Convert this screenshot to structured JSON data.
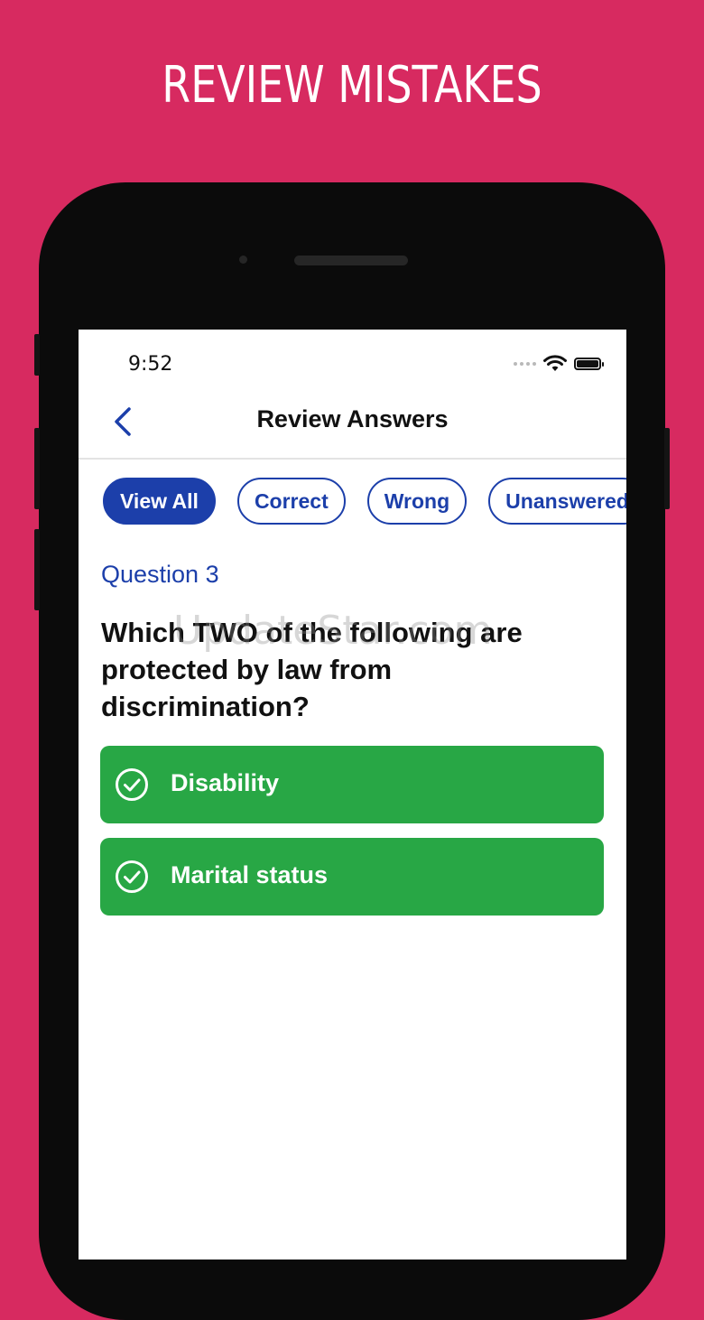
{
  "banner": {
    "headline": "REVIEW MISTAKES"
  },
  "status_bar": {
    "time": "9:52"
  },
  "nav": {
    "title": "Review Answers"
  },
  "filters": [
    {
      "label": "View All",
      "active": true
    },
    {
      "label": "Correct",
      "active": false
    },
    {
      "label": "Wrong",
      "active": false
    },
    {
      "label": "Unanswered",
      "active": false
    }
  ],
  "question": {
    "number_label": "Question 3",
    "text": "Which TWO of the following are protected by law from discrimination?"
  },
  "answers": [
    {
      "label": "Disability",
      "state": "correct"
    },
    {
      "label": "Marital status",
      "state": "correct"
    }
  ],
  "watermark": "UpdateStar.com",
  "colors": {
    "background": "#d72a60",
    "accent": "#1c3faa",
    "correct": "#28a745"
  },
  "icons": {
    "back": "chevron-left-icon",
    "answer": "check-circle-icon"
  }
}
